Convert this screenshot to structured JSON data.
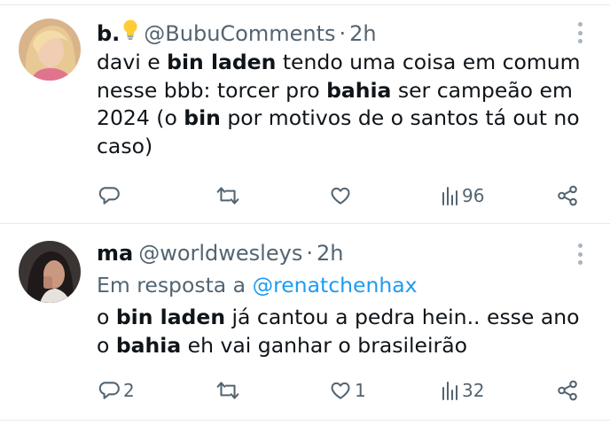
{
  "tweets": [
    {
      "name": "b.",
      "name_emoji": "lightbulb-icon",
      "handle": "@BubuComments",
      "dot": "·",
      "time": "2h",
      "text_parts": [
        "davi e ",
        "bin laden",
        " tendo uma coisa em comum nesse bbb: torcer pro ",
        "bahia",
        " ser campeão em 2024 (o ",
        "bin",
        " por motivos de o santos tá out no caso)"
      ],
      "actions": {
        "reply_count": "",
        "retweet_count": "",
        "like_count": "",
        "views_count": "96"
      }
    },
    {
      "name": "ma",
      "handle": "@worldwesleys",
      "dot": "·",
      "time": "2h",
      "reply_prefix": "Em resposta a",
      "reply_to": "@renatchenhax",
      "text_parts": [
        "o ",
        "bin laden",
        " já cantou a pedra hein.. esse ano o ",
        "bahia",
        " eh vai ganhar o brasileirão"
      ],
      "actions": {
        "reply_count": "2",
        "retweet_count": "",
        "like_count": "1",
        "views_count": "32"
      }
    }
  ],
  "colors": {
    "text": "#0f1419",
    "secondary": "#536471",
    "link": "#1d9bf0",
    "divider": "#e6e9ec"
  }
}
